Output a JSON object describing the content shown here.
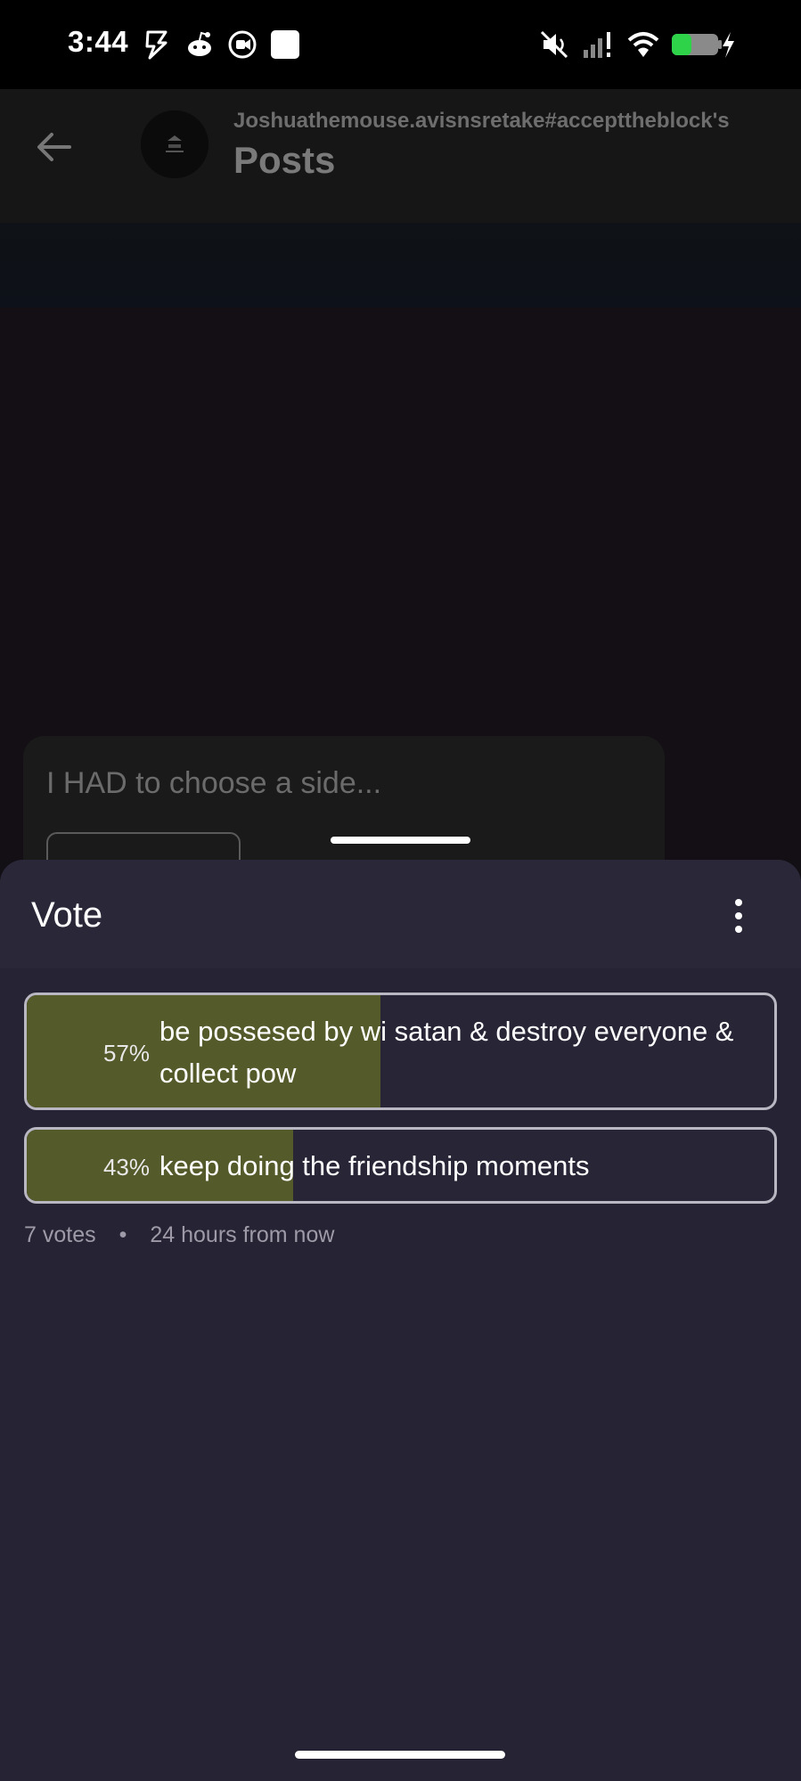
{
  "status_bar": {
    "time": "3:44",
    "icons": [
      "flash-icon",
      "reddit-icon",
      "screen-record-icon",
      "app-square-icon",
      "mute-icon",
      "signal-icon",
      "wifi-icon",
      "battery-charging-icon"
    ]
  },
  "header": {
    "subtitle": "Joshuathemouse.avisnsretake#accepttheblock's",
    "title": "Posts"
  },
  "post": {
    "title": "I HAD to choose a side..."
  },
  "sheet": {
    "title": "Vote",
    "options": [
      {
        "percent_label": "57%",
        "percent": 57,
        "text": "be possesed by wi satan & destroy everyone & collect pow"
      },
      {
        "percent_label": "43%",
        "percent": 43,
        "text": "keep doing the friendship moments"
      }
    ],
    "votes": "7 votes",
    "separator": "•",
    "time_left": "24 hours from now"
  },
  "colors": {
    "sheet_bg": "#262334",
    "poll_fill": "#555a2a",
    "poll_border": "#b9b7c2",
    "meta_text": "#9e9aa8"
  }
}
